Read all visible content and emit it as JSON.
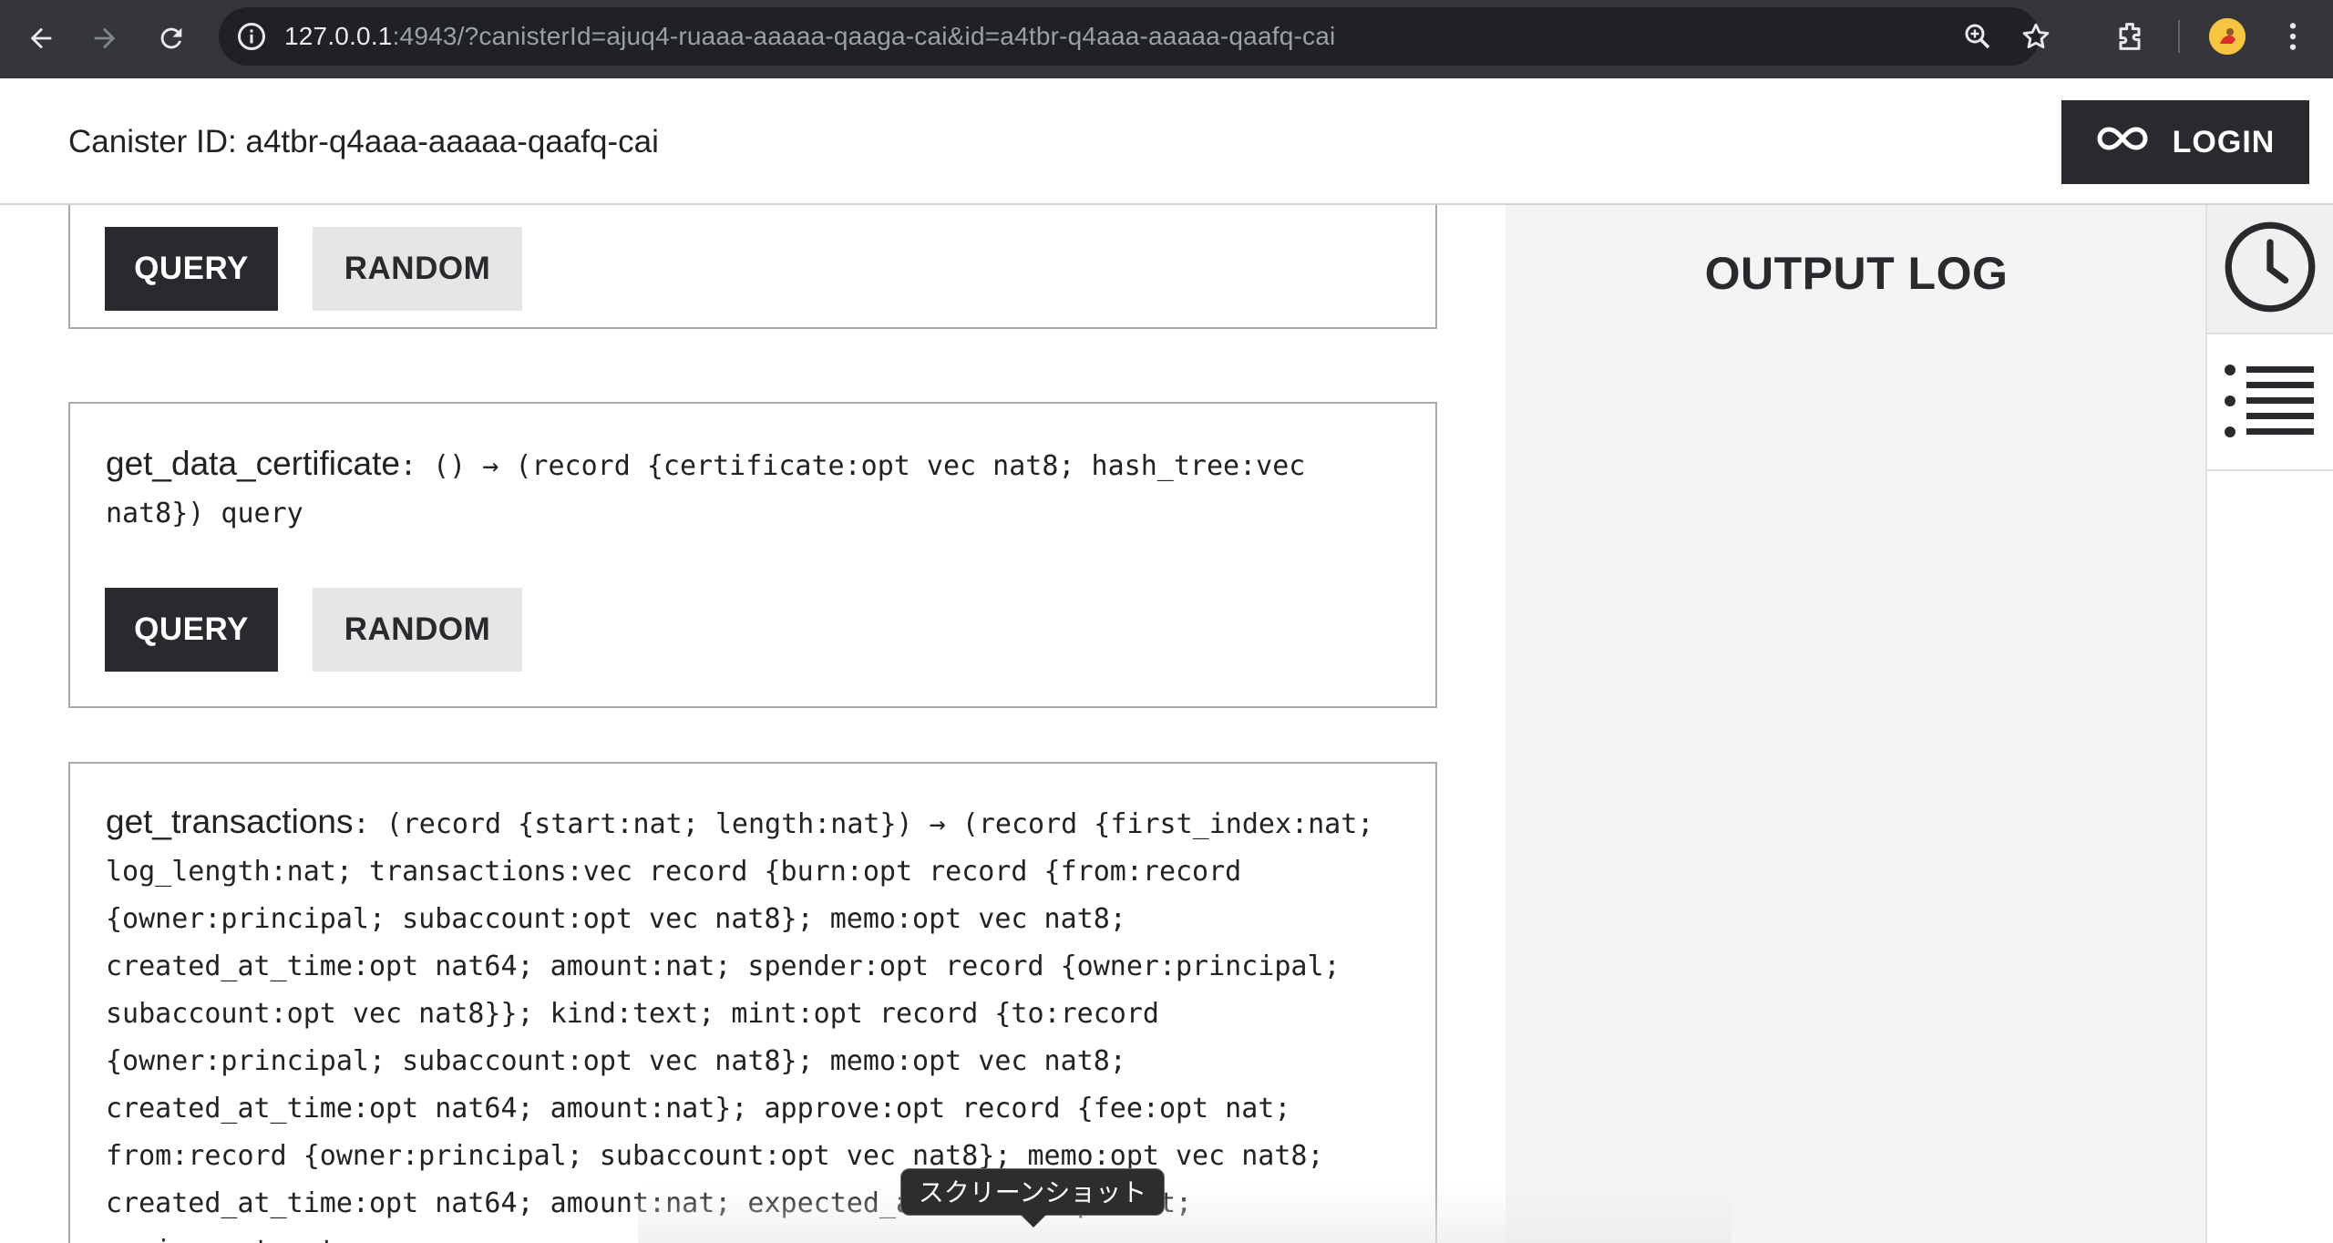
{
  "browser": {
    "url_host": "127.0.0.1",
    "url_rest": ":4943/?canisterId=ajuq4-ruaaa-aaaaa-qaaga-cai&id=a4tbr-q4aaa-aaaaa-qaafq-cai",
    "icons": [
      "back-icon",
      "forward-icon",
      "reload-icon",
      "site-info-icon",
      "zoom-icon",
      "bookmark-star-icon",
      "extensions-icon",
      "profile-avatar",
      "more-menu-icon"
    ]
  },
  "header": {
    "canister_label": "Canister ID: a4tbr-q4aaa-aaaaa-qaafq-cai",
    "login_label": "LOGIN"
  },
  "methods": [
    {
      "name": "",
      "signature": "",
      "query_label": "QUERY",
      "random_label": "RANDOM"
    },
    {
      "name": "get_data_certificate",
      "signature": ": () → (record {certificate:opt vec nat8; hash_tree:vec nat8}) query",
      "query_label": "QUERY",
      "random_label": "RANDOM"
    },
    {
      "name": "get_transactions",
      "signature": ": (record {start:nat; length:nat}) → (record {first_index:nat; log_length:nat; transactions:vec record {burn:opt record {from:record {owner:principal; subaccount:opt vec nat8}; memo:opt vec nat8; created_at_time:opt nat64; amount:nat; spender:opt record {owner:principal; subaccount:opt vec nat8}}; kind:text; mint:opt record {to:record {owner:principal; subaccount:opt vec nat8}; memo:opt vec nat8; created_at_time:opt nat64; amount:nat}; approve:opt record {fee:opt nat; from:record {owner:principal; subaccount:opt vec nat8}; memo:opt vec nat8; created_at_time:opt nat64; amount:nat; expected_allowance:opt nat; expires_at:opt"
    }
  ],
  "output_log": {
    "title": "OUTPUT LOG"
  },
  "tooltip": {
    "text": "スクリーンショット"
  }
}
